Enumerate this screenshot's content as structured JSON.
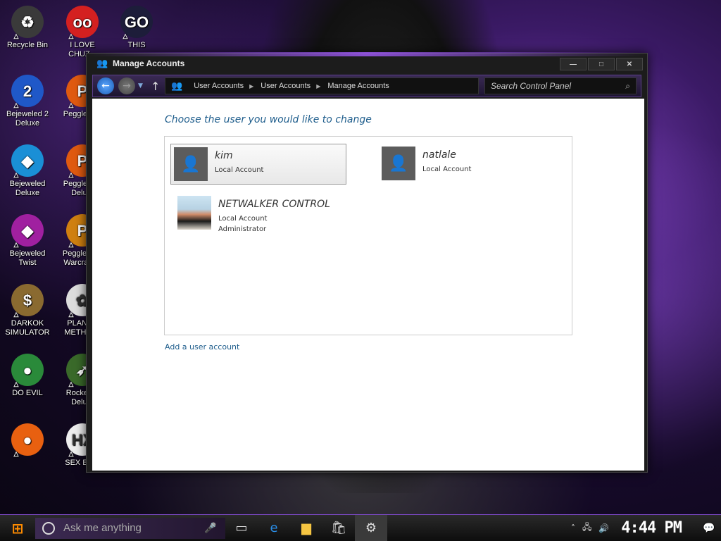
{
  "desktop": {
    "icons": [
      {
        "label": "Recycle Bin",
        "icon": "recycle-bin-icon",
        "color": "#3a3a3a",
        "glyph": "♻"
      },
      {
        "label": "I LOVE CHUZ...",
        "icon": "app-icon",
        "color": "#d42020",
        "glyph": "oo"
      },
      {
        "label": "THIS",
        "icon": "goland-icon",
        "color": "#1d1d3a",
        "glyph": "GO"
      },
      {
        "label": "Bejeweled 2 Deluxe",
        "icon": "bejeweled-2-icon",
        "color": "#1f58c8",
        "glyph": "2"
      },
      {
        "label": "Peggle D...",
        "icon": "peggle-icon",
        "color": "#e05a10",
        "glyph": "P"
      },
      {
        "label": "Bejeweled Deluxe",
        "icon": "diamond-icon",
        "color": "#1a8fd6",
        "glyph": "◆"
      },
      {
        "label": "Peggle N... Delu...",
        "icon": "peggle-nights-icon",
        "color": "#e05a10",
        "glyph": "P"
      },
      {
        "label": "Bejeweled Twist",
        "icon": "bejeweled-twist-icon",
        "color": "#a020a0",
        "glyph": "◆"
      },
      {
        "label": "Peggle W... Warcraft ...",
        "icon": "peggle-warcraft-icon",
        "color": "#d08010",
        "glyph": "P"
      },
      {
        "label": "DARKOK SIMULATOR",
        "icon": "money-bag-icon",
        "color": "#8a6a30",
        "glyph": "$"
      },
      {
        "label": "PLANT... METH U...",
        "icon": "flower-icon",
        "color": "#dddddd",
        "glyph": "✿"
      },
      {
        "label": "DO EVIL",
        "icon": "chrome-icon",
        "color": "#2a8a3a",
        "glyph": "●"
      },
      {
        "label": "Rocket ... Delu...",
        "icon": "rocket-icon",
        "color": "#3a6a2a",
        "glyph": "➶"
      },
      {
        "label": "",
        "icon": "firefox-icon",
        "color": "#e86010",
        "glyph": "●"
      },
      {
        "label": "SEX ED...",
        "icon": "hex-icon",
        "color": "#eeeeee",
        "glyph": "HX"
      }
    ]
  },
  "window": {
    "title": "Manage Accounts",
    "controls": {
      "minimize": "—",
      "maximize": "□",
      "close": "✕"
    },
    "breadcrumbs": [
      "User Accounts",
      "User Accounts",
      "Manage Accounts"
    ],
    "search_placeholder": "Search Control Panel",
    "heading": "Choose the user you would like to change",
    "accounts": [
      {
        "name": "kim",
        "type": "Local Account",
        "role": "",
        "selected": true,
        "avatar": "default"
      },
      {
        "name": "natlale",
        "type": "Local Account",
        "role": "",
        "selected": false,
        "avatar": "default"
      },
      {
        "name": "NETWALKER CONTROL",
        "type": "Local Account",
        "role": "Administrator",
        "selected": false,
        "avatar": "photo"
      }
    ],
    "add_link": "Add a user account"
  },
  "taskbar": {
    "search_placeholder": "Ask me anything",
    "clock": "4:44 PM",
    "accent": "#7b48c4"
  }
}
